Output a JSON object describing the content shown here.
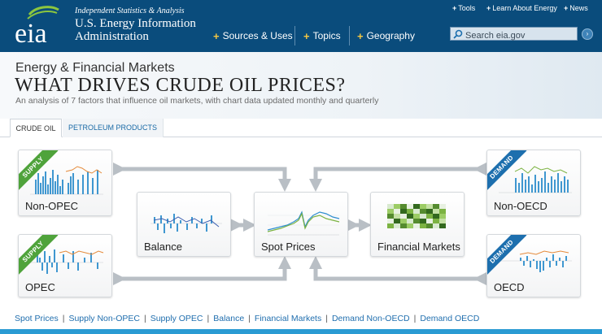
{
  "header": {
    "logo_text": "eia",
    "tagline": "Independent Statistics & Analysis",
    "org_line1": "U.S. Energy Information",
    "org_line2": "Administration",
    "util_links": [
      {
        "label": "Tools"
      },
      {
        "label": "Learn About Energy"
      },
      {
        "label": "News"
      }
    ],
    "nav": [
      {
        "label": "Sources & Uses"
      },
      {
        "label": "Topics"
      },
      {
        "label": "Geography"
      }
    ],
    "search": {
      "placeholder": "Search eia.gov",
      "icon": "search-icon"
    },
    "colors": {
      "header_bg": "#0a4c7c",
      "nav_plus": "#f5c842"
    }
  },
  "page": {
    "subtitle": "Energy & Financial Markets",
    "title": "WHAT DRIVES CRUDE OIL PRICES?",
    "description": "An analysis of 7 factors that influence oil markets, with chart data updated monthly and quarterly"
  },
  "tabs": [
    {
      "label": "CRUDE OIL",
      "active": true
    },
    {
      "label": "PETROLEUM PRODUCTS",
      "active": false
    }
  ],
  "diagram": {
    "cards": {
      "non_opec": {
        "label": "Non-OPEC",
        "ribbon": "SUPPLY"
      },
      "opec": {
        "label": "OPEC",
        "ribbon": "SUPPLY"
      },
      "balance": {
        "label": "Balance"
      },
      "spot_prices": {
        "label": "Spot Prices"
      },
      "financial_markets": {
        "label": "Financial Markets"
      },
      "non_oecd": {
        "label": "Non-OECD",
        "ribbon": "DEMAND"
      },
      "oecd": {
        "label": "OECD",
        "ribbon": "DEMAND"
      }
    },
    "colors": {
      "supply_ribbon": "#4fa33b",
      "demand_ribbon": "#1d6fae",
      "arrow": "#b9bfc5"
    }
  },
  "footer_links": [
    "Spot Prices",
    "Supply Non-OPEC",
    "Supply OPEC",
    "Balance",
    "Financial Markets",
    "Demand Non-OECD",
    "Demand OECD"
  ]
}
